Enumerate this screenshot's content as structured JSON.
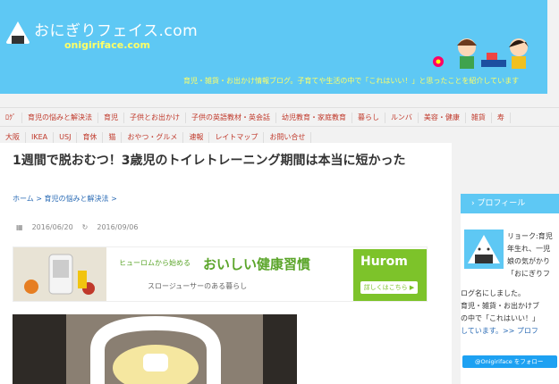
{
  "header": {
    "site_title": "おにぎりフェイス.com",
    "site_sub": "onigiriface.com",
    "tagline": "育児・雑貨・お出かけ情報ブログ。子育てや生活の中で「これはいい！」と思ったことを紹介しています"
  },
  "nav": {
    "row1": [
      "ﾛｸﾞ",
      "育児の悩みと解決法",
      "育児",
      "子供とお出かけ",
      "子供の英語教材・英会話",
      "幼児教育・家庭教育",
      "暮らし",
      "ルンバ",
      "美容・健康",
      "雑貨",
      "寿"
    ],
    "row2": [
      "大阪",
      "IKEA",
      "USJ",
      "育休",
      "猫",
      "おやつ・グルメ",
      "速報",
      "レイトマップ",
      "お問い合せ"
    ]
  },
  "article": {
    "title": "1週間で脱おむつ！3歳児のトイレトレーニング期間は本当に短かった",
    "breadcrumb": "ホーム > 育児の悩みと解決法 >",
    "published": "2016/06/20",
    "updated": "2016/09/06"
  },
  "ad": {
    "head": "ヒューロムから始める",
    "big": "おいしい健康習慣",
    "sub": "スロージューサーのある暮らし",
    "brand": "Hurom",
    "button": "詳しくはこちら ▶"
  },
  "sidebar": {
    "profile_title": "プロフィール",
    "lines": [
      "リョーク:育児",
      "年生れ、一児",
      "娘の気がかり",
      "「おにぎりフ",
      "ログ名にしました。",
      "育児・雑貨・お出かけブ",
      "の中で「これはいい！」",
      "しています。>> プロフ"
    ],
    "follow": "@Onigiriface をフォロー"
  },
  "colors": {
    "header_bg": "#5ec8f4",
    "accent_yellow": "#ffff66",
    "nav_text": "#c0392b",
    "link": "#2a6bb5",
    "ad_green": "#7dc32a"
  }
}
